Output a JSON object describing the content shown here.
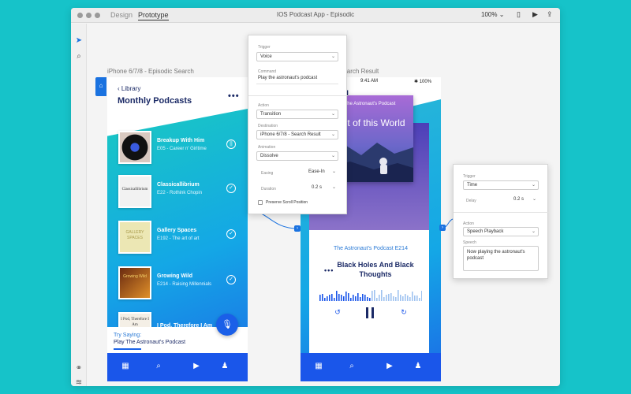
{
  "app": {
    "mode_tabs": [
      "Design",
      "Prototype"
    ],
    "window_title": "IOS Podcast App - Episodic",
    "zoom": "100%"
  },
  "left_tools": {
    "top": [
      "select-arrow",
      "zoom-search"
    ],
    "bottom": [
      "plugins",
      "layers"
    ]
  },
  "artboard_left": {
    "label": "iPhone 6/7/8 - Episodic Search",
    "back_label": "Library",
    "title": "Monthly Podcasts",
    "more": "•••",
    "podcasts": [
      {
        "name": "Breakup With Him",
        "sub": "E05 - Career n' Girltime",
        "status": "playing",
        "status_glyph": "||"
      },
      {
        "name": "Classicallibrium",
        "sub": "E22 - Rothink Chopin",
        "status": "done",
        "status_glyph": "✓"
      },
      {
        "name": "Gallery Spaces",
        "sub": "E192 - The art of art",
        "status": "done",
        "status_glyph": "✓"
      },
      {
        "name": "Growing Wild",
        "sub": "E214 - Raising Millennials",
        "status": "done",
        "status_glyph": "✓"
      },
      {
        "name": "I Pod, Therefore I Am",
        "sub": "",
        "status": "none",
        "status_glyph": ""
      }
    ],
    "thumb_texts": [
      "",
      "Classicallibrium",
      "GALLERY SPACES",
      "Growing Wild",
      "I Pod, Therefore I Am"
    ],
    "try_saying_label": "Try Saying:",
    "try_saying_text": "Play The Astronaut's Podcast",
    "nav_icons": [
      "grid-icon",
      "search-icon",
      "play-icon",
      "profile-icon"
    ]
  },
  "artboard_right": {
    "label": "iPhone 6/7/8 - Search Result",
    "label_visible": "Search Result",
    "status_time": "9:41 AM",
    "status_battery": "100%",
    "title_partial": "ing",
    "cover_title": "The Astronaut's Podcast",
    "cover_big": "Out of this World",
    "episode": "The Astronaut's Podcast E214",
    "episode_title": "Black Holes And Black Thoughts",
    "more": "•••"
  },
  "voice_popover": {
    "trigger_label": "Trigger",
    "trigger_value": "Voice",
    "command_label": "Command",
    "command_value": "Play the astronaut's podcast",
    "action_label": "Action",
    "action_value": "Transition",
    "destination_label": "Destination",
    "destination_value": "iPhone 6/7/8 - Search Result",
    "animation_label": "Animation",
    "animation_value": "Dissolve",
    "easing_label": "Easing",
    "easing_value": "Ease-In",
    "duration_label": "Duration",
    "duration_value": "0.2 s",
    "preserve_label": "Preserve Scroll Position",
    "preserve_checked": false
  },
  "time_popover": {
    "trigger_label": "Trigger",
    "trigger_value": "Time",
    "delay_label": "Delay",
    "delay_value": "0.2 s",
    "action_label": "Action",
    "action_value": "Speech Playback",
    "speech_label": "Speech",
    "speech_value": "Now playing the astronaut's podcast"
  },
  "colors": {
    "background": "#16c3c9",
    "accent_blue": "#1a56ea",
    "navy": "#1b2a66"
  }
}
